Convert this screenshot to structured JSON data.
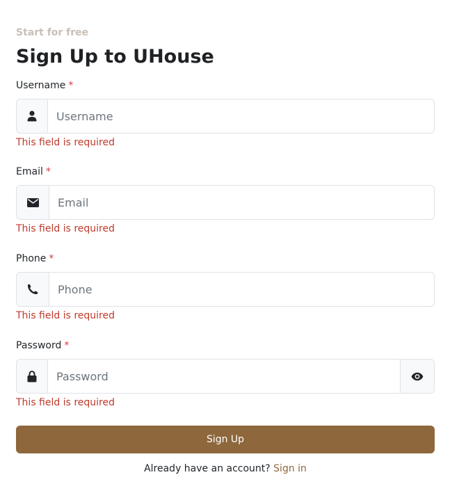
{
  "header": {
    "eyebrow": "Start for free",
    "title": "Sign Up to UHouse"
  },
  "fields": {
    "username": {
      "label": "Username",
      "required_marker": "*",
      "placeholder": "Username",
      "icon": "user-icon",
      "error": "This field is required"
    },
    "email": {
      "label": "Email",
      "required_marker": "*",
      "placeholder": "Email",
      "icon": "envelope-icon",
      "error": "This field is required"
    },
    "phone": {
      "label": "Phone",
      "required_marker": "*",
      "placeholder": "Phone",
      "icon": "phone-icon",
      "error": "This field is required"
    },
    "password": {
      "label": "Password",
      "required_marker": "*",
      "placeholder": "Password",
      "icon": "lock-icon",
      "toggle_icon": "eye-icon",
      "error": "This field is required"
    }
  },
  "actions": {
    "submit_label": "Sign Up"
  },
  "footer": {
    "prompt": "Already have an account?",
    "link_label": "Sign in"
  },
  "colors": {
    "accent": "#8e673c",
    "error": "#c0392b",
    "required": "#dc3545",
    "eyebrow": "#c9bfb6"
  }
}
